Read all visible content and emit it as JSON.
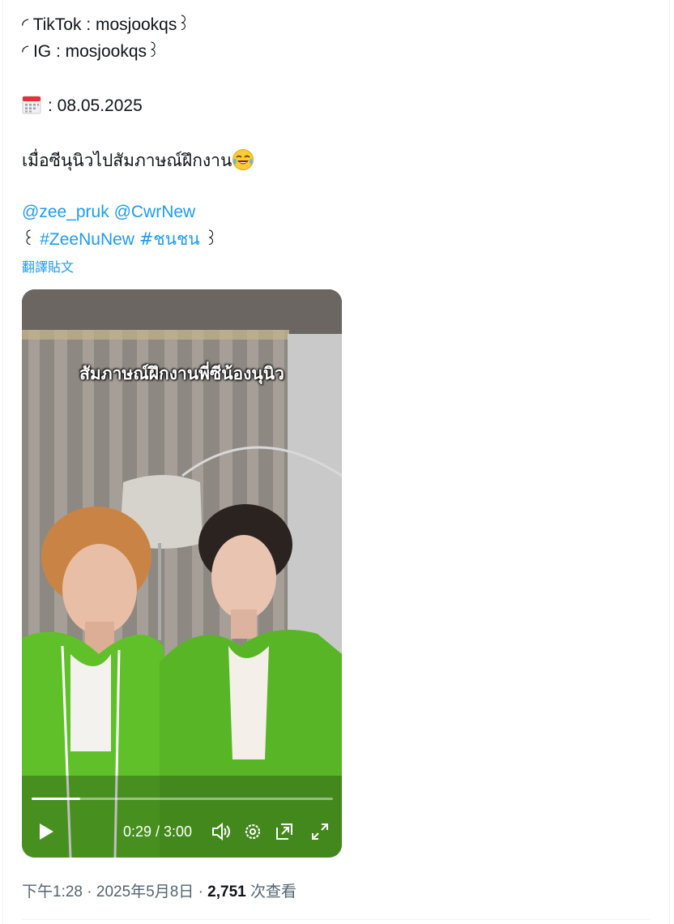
{
  "tweet": {
    "tiktok_line": "◜ TikTok : mosjookqs꒱",
    "ig_line": "◜ IG : mosjookqs꒱",
    "date_text": ": 08.05.2025",
    "date_icon": "calendar-icon",
    "caption_text": "เมื่อซีนุนิวไปสัมภาษณ์ฝึกงาน",
    "caption_emoji": "tears-of-joy-emoji",
    "mention1": "@zee_pruk",
    "mention2": "@CwrNew",
    "hashtag_prefix": "꒰",
    "hashtag1": "#ZeeNuNew",
    "hashtag2": "#ชนชน",
    "hashtag_suffix": "꒱",
    "translate_label": "翻譯貼文"
  },
  "video": {
    "overlay_caption": "สัมภาษณ์ฝึกงานพี่ซีน้องนุนิว",
    "time_display": "0:29 / 3:00",
    "progress_fraction": 0.161,
    "controls": [
      "play-icon",
      "volume-icon",
      "settings-icon",
      "pip-icon",
      "fullscreen-icon"
    ]
  },
  "meta": {
    "time": "下午1:28",
    "sep1": "·",
    "date": "2025年5月8日",
    "sep2": "·",
    "views_count": "2,751",
    "views_label": "次查看"
  },
  "colors": {
    "link": "#1d9bf0",
    "text": "#0f1419",
    "muted": "#536471",
    "jacket_green": "#5fc02a"
  }
}
